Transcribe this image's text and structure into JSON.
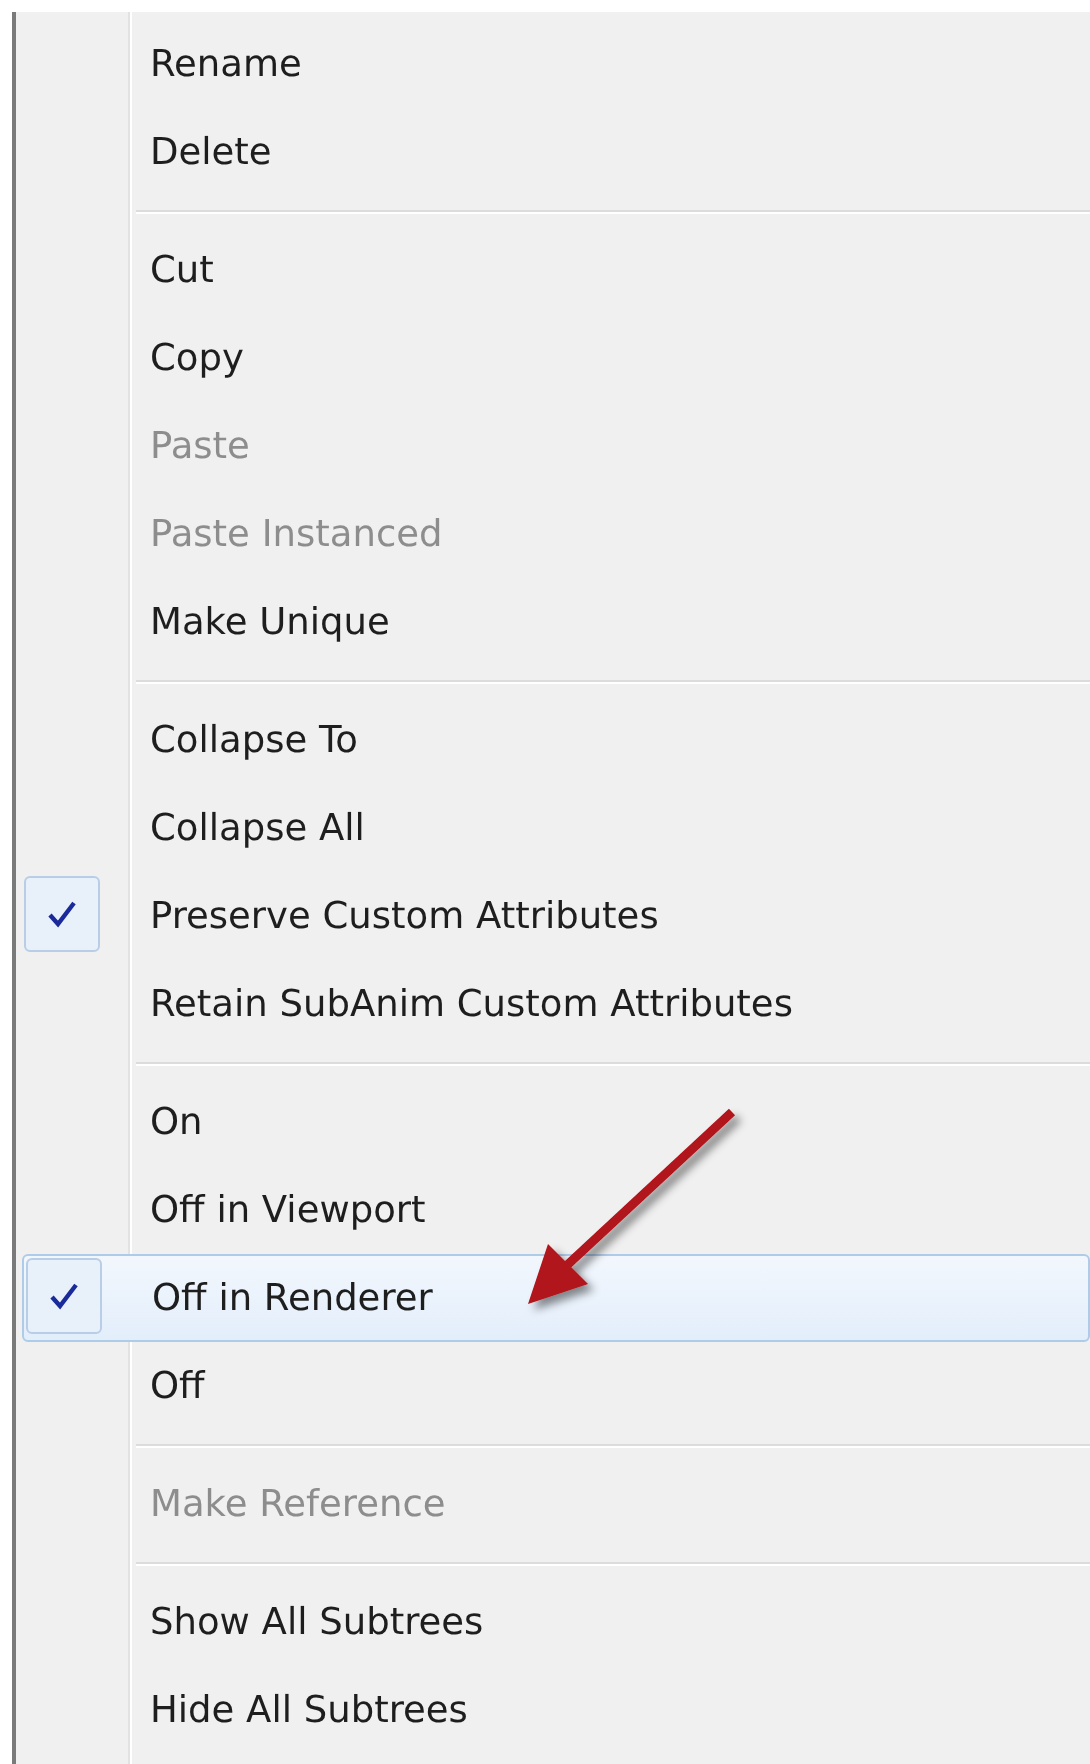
{
  "menu": {
    "sections": [
      {
        "items": [
          {
            "label": "Rename",
            "checked": false,
            "disabled": false,
            "selected": false
          },
          {
            "label": "Delete",
            "checked": false,
            "disabled": false,
            "selected": false
          }
        ]
      },
      {
        "items": [
          {
            "label": "Cut",
            "checked": false,
            "disabled": false,
            "selected": false
          },
          {
            "label": "Copy",
            "checked": false,
            "disabled": false,
            "selected": false
          },
          {
            "label": "Paste",
            "checked": false,
            "disabled": true,
            "selected": false
          },
          {
            "label": "Paste Instanced",
            "checked": false,
            "disabled": true,
            "selected": false
          },
          {
            "label": "Make Unique",
            "checked": false,
            "disabled": false,
            "selected": false
          }
        ]
      },
      {
        "items": [
          {
            "label": "Collapse To",
            "checked": false,
            "disabled": false,
            "selected": false
          },
          {
            "label": "Collapse All",
            "checked": false,
            "disabled": false,
            "selected": false
          },
          {
            "label": "Preserve Custom Attributes",
            "checked": true,
            "disabled": false,
            "selected": false
          },
          {
            "label": "Retain SubAnim Custom Attributes",
            "checked": false,
            "disabled": false,
            "selected": false
          }
        ]
      },
      {
        "items": [
          {
            "label": "On",
            "checked": false,
            "disabled": false,
            "selected": false
          },
          {
            "label": "Off in Viewport",
            "checked": false,
            "disabled": false,
            "selected": false
          },
          {
            "label": "Off in Renderer",
            "checked": true,
            "disabled": false,
            "selected": true
          },
          {
            "label": "Off",
            "checked": false,
            "disabled": false,
            "selected": false
          }
        ]
      },
      {
        "items": [
          {
            "label": "Make Reference",
            "checked": false,
            "disabled": true,
            "selected": false
          }
        ]
      },
      {
        "items": [
          {
            "label": "Show All Subtrees",
            "checked": false,
            "disabled": false,
            "selected": false
          },
          {
            "label": "Hide All Subtrees",
            "checked": false,
            "disabled": false,
            "selected": false
          }
        ]
      }
    ]
  }
}
